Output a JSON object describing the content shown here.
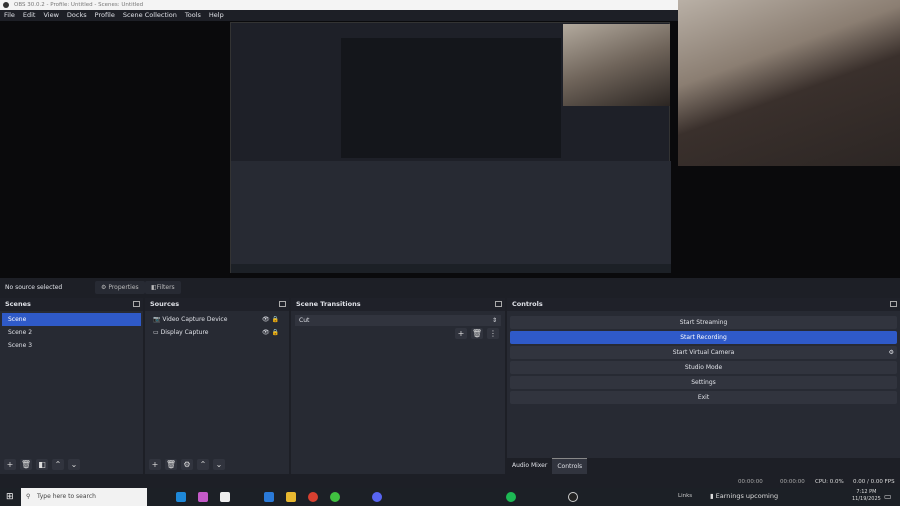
{
  "window": {
    "title": "OBS 30.0.2 - Profile: Untitled - Scenes: Untitled"
  },
  "menu": [
    "File",
    "Edit",
    "View",
    "Docks",
    "Profile",
    "Scene Collection",
    "Tools",
    "Help"
  ],
  "source_bar": {
    "status": "No source selected",
    "properties": "Properties",
    "filters": "Filters"
  },
  "scenes": {
    "title": "Scenes",
    "items": [
      "Scene",
      "Scene 2",
      "Scene 3"
    ],
    "selected": 0
  },
  "sources": {
    "title": "Sources",
    "items": [
      {
        "label": "Video Capture Device",
        "icon": "camera-icon"
      },
      {
        "label": "Display Capture",
        "icon": "monitor-icon"
      }
    ]
  },
  "transitions": {
    "title": "Scene Transitions",
    "selected": "Cut"
  },
  "controls": {
    "title": "Controls",
    "buttons": [
      "Start Streaming",
      "Start Recording",
      "Start Virtual Camera",
      "Studio Mode",
      "Settings",
      "Exit"
    ],
    "highlighted": 1
  },
  "dock_tabs": [
    "Audio Mixer",
    "Controls"
  ],
  "status": {
    "stream_time": "00:00:00",
    "rec_time": "00:00:00",
    "cpu": "CPU: 0.0%",
    "fps": "0.00 / 0.00 FPS"
  },
  "taskbar": {
    "search_placeholder": "Type here to search",
    "links": "Links",
    "news": "Earnings upcoming",
    "time": "7:12 PM",
    "date": "11/19/2025"
  },
  "colors": {
    "accent": "#2f5ac8",
    "background": "#1d1f26",
    "panel": "#272a33"
  }
}
